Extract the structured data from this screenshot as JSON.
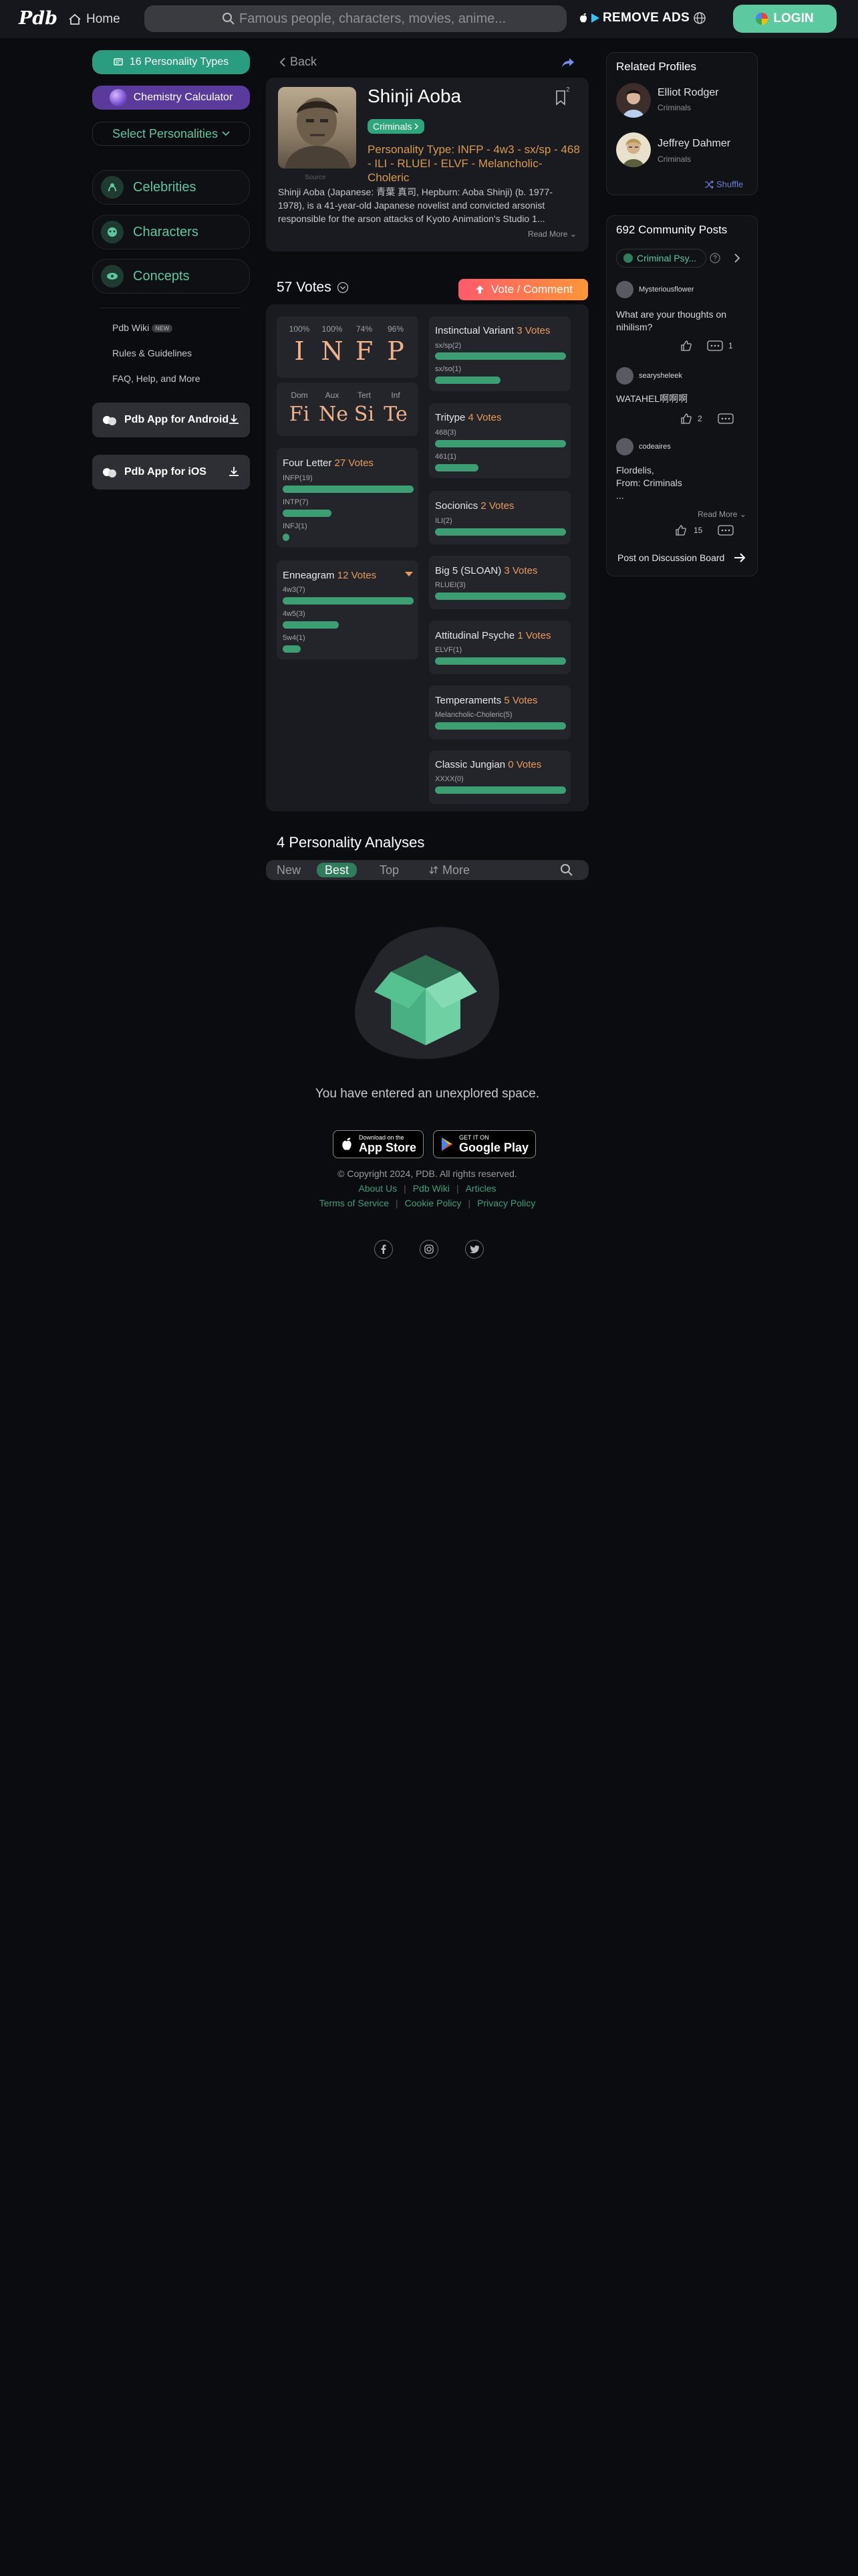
{
  "header": {
    "logo": "Pdb",
    "home": "Home",
    "search_placeholder": "Famous people, characters, movies, anime...",
    "remove_ads": "REMOVE ADS",
    "login": "LOGIN"
  },
  "sidebar": {
    "btn_16types": "16 Personality Types",
    "btn_chemistry": "Chemistry Calculator",
    "btn_select": "Select Personalities",
    "categories": [
      "Celebrities",
      "Characters",
      "Concepts"
    ],
    "links": [
      "Pdb Wiki",
      "Rules & Guidelines",
      "FAQ, Help, and More"
    ],
    "new_badge": "NEW",
    "android": "Pdb App for Android",
    "ios": "Pdb App for iOS"
  },
  "profile": {
    "back": "Back",
    "name": "Shinji Aoba",
    "bookmark_count": "2",
    "tag": "Criminals",
    "type_line": "Personality Type: INFP - 4w3 - sx/sp - 468 - ILI - RLUEI - ELVF - Melancholic-Choleric",
    "photo_credit": "Source",
    "description": "Shinji Aoba (Japanese: 青葉 真司, Hepburn: Aoba Shinji) (b. 1977-1978), is a 41-year-old Japanese novelist and convicted arsonist responsible for the arson attacks of Kyoto Animation's Studio 1...",
    "read_more": "Read More"
  },
  "votes": {
    "title": "57 Votes",
    "vote_button": "Vote / Comment",
    "letters": [
      {
        "pct": "100%",
        "letter": "I"
      },
      {
        "pct": "100%",
        "letter": "N"
      },
      {
        "pct": "74%",
        "letter": "F"
      },
      {
        "pct": "96%",
        "letter": "P"
      }
    ],
    "functions": [
      {
        "label": "Dom",
        "fn": "Fi"
      },
      {
        "label": "Aux",
        "fn": "Ne"
      },
      {
        "label": "Tert",
        "fn": "Si"
      },
      {
        "label": "Inf",
        "fn": "Te"
      }
    ],
    "four_letter": {
      "title": "Four Letter",
      "count": "27 Votes",
      "rows": [
        {
          "label": "INFP(19)",
          "frac": 1.0
        },
        {
          "label": "INTP(7)",
          "frac": 0.37
        },
        {
          "label": "INFJ(1)",
          "frac": 0.05
        }
      ]
    },
    "enneagram": {
      "title": "Enneagram",
      "count": "12 Votes",
      "rows": [
        {
          "label": "4w3(7)",
          "frac": 1.0
        },
        {
          "label": "4w5(3)",
          "frac": 0.43
        },
        {
          "label": "5w4(1)",
          "frac": 0.14
        }
      ]
    },
    "instinctual": {
      "title": "Instinctual Variant",
      "count": "3 Votes",
      "rows": [
        {
          "label": "sx/sp(2)",
          "frac": 1.0
        },
        {
          "label": "sx/so(1)",
          "frac": 0.5
        }
      ]
    },
    "tritype": {
      "title": "Tritype",
      "count": "4 Votes",
      "rows": [
        {
          "label": "468(3)",
          "frac": 1.0
        },
        {
          "label": "461(1)",
          "frac": 0.33
        }
      ]
    },
    "socionics": {
      "title": "Socionics",
      "count": "2 Votes",
      "rows": [
        {
          "label": "ILI(2)",
          "frac": 1.0
        }
      ]
    },
    "bigfive": {
      "title": "Big 5 (SLOAN)",
      "count": "3 Votes",
      "rows": [
        {
          "label": "RLUEI(3)",
          "frac": 1.0
        }
      ]
    },
    "attitudinal": {
      "title": "Attitudinal Psyche",
      "count": "1 Votes",
      "rows": [
        {
          "label": "ELVF(1)",
          "frac": 1.0
        }
      ]
    },
    "temperaments": {
      "title": "Temperaments",
      "count": "5 Votes",
      "rows": [
        {
          "label": "Melancholic-Choleric(5)",
          "frac": 1.0
        }
      ]
    },
    "jungian": {
      "title": "Classic Jungian",
      "count": "0 Votes",
      "rows": [
        {
          "label": "XXXX(0)",
          "frac": 1.0
        }
      ]
    }
  },
  "analyses": {
    "title": "4 Personality Analyses",
    "tabs": [
      "New",
      "Best",
      "Top",
      "More"
    ],
    "empty": "You have entered an unexplored space."
  },
  "footer": {
    "appstore_small": "Download on the",
    "appstore_big": "App Store",
    "gplay_small": "GET IT ON",
    "gplay_big": "Google Play",
    "copyright": "© Copyright 2024, PDB. All rights reserved.",
    "links1": [
      "About Us",
      "Pdb Wiki",
      "Articles"
    ],
    "links2": [
      "Terms of Service",
      "Cookie Policy",
      "Privacy Policy"
    ]
  },
  "related": {
    "title": "Related Profiles",
    "items": [
      {
        "name": "Elliot Rodger",
        "sub": "Criminals"
      },
      {
        "name": "Jeffrey Dahmer",
        "sub": "Criminals"
      }
    ],
    "shuffle": "Shuffle"
  },
  "community": {
    "title": "692 Community Posts",
    "chip": "Criminal Psy...",
    "posts": [
      {
        "user": "Mysteriousflower",
        "text": "What are your thoughts on nihilism?",
        "likes": "",
        "comments": "1"
      },
      {
        "user": "searysheleek",
        "text": "WATAHEL啊啊啊",
        "likes": "2",
        "comments": ""
      },
      {
        "user": "codeaires",
        "text": "Flordelis,\nFrom: Criminals\n...",
        "likes": "15",
        "comments": ""
      }
    ],
    "read_more": "Read More",
    "discussion": "Post on Discussion Board"
  },
  "colors": {
    "accent_green": "#5cc9a0",
    "orange": "#e89a5a",
    "bar_green": "#3d9e73"
  }
}
